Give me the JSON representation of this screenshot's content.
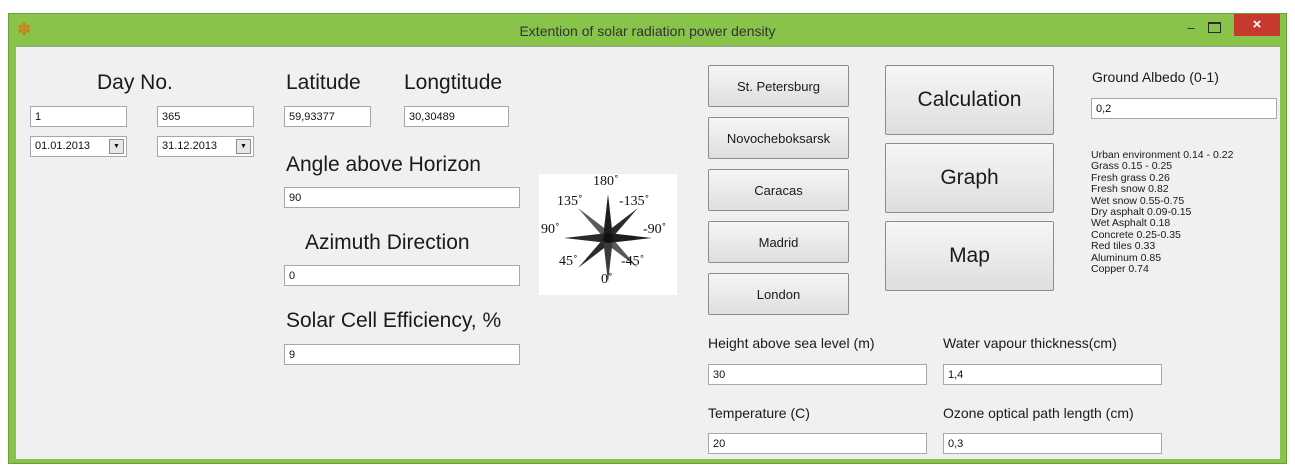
{
  "window": {
    "title": "Extention of solar radiation power density",
    "close_glyph": "×",
    "minimize_glyph": "–"
  },
  "day": {
    "label": "Day No.",
    "start_value": "1",
    "end_value": "365",
    "start_date": "01.01.2013",
    "end_date": "31.12.2013"
  },
  "location": {
    "latitude_label": "Latitude",
    "longitude_label": "Longtitude",
    "latitude_value": "59,93377",
    "longitude_value": "30,30489"
  },
  "angle": {
    "label": "Angle above Horizon",
    "value": "90"
  },
  "azimuth": {
    "label": "Azimuth Direction",
    "value": "0"
  },
  "efficiency": {
    "label": "Solar Cell Efficiency, %",
    "value": "9"
  },
  "compass": {
    "labels": [
      "180˚",
      "135˚",
      "-135˚",
      "90˚",
      "-90˚",
      "45˚",
      "-45˚",
      "0˚"
    ],
    "colors": {
      "star_dark": "#1e1e1e",
      "star_light": "#6a6a6a"
    }
  },
  "cities": [
    "St. Petersburg",
    "Novocheboksarsk",
    "Caracas",
    "Madrid",
    "London"
  ],
  "actions": {
    "calculation": "Calculation",
    "graph": "Graph",
    "map": "Map"
  },
  "albedo": {
    "label": "Ground Albedo (0-1)",
    "value": "0,2",
    "list": [
      "Urban environment 0.14 - 0.22",
      "Grass 0.15 - 0.25",
      "Fresh grass 0.26",
      "Fresh snow 0.82",
      "Wet snow 0.55-0.75",
      "Dry asphalt 0.09-0.15",
      "Wet Asphalt 0.18",
      "Concrete 0.25-0.35",
      "Red tiles 0.33",
      "Aluminum 0.85",
      "Copper 0.74"
    ]
  },
  "params": {
    "height_label": "Height above sea level (m)",
    "height_value": "30",
    "water_label": "Water vapour thickness(cm)",
    "water_value": "1,4",
    "temp_label": "Temperature (C)",
    "temp_value": "20",
    "ozone_label": "Ozone optical path length (cm)",
    "ozone_value": "0,3"
  },
  "colors": {
    "frame": "#88c34a",
    "client": "#f0f0f0",
    "close_button": "#c7392f"
  }
}
